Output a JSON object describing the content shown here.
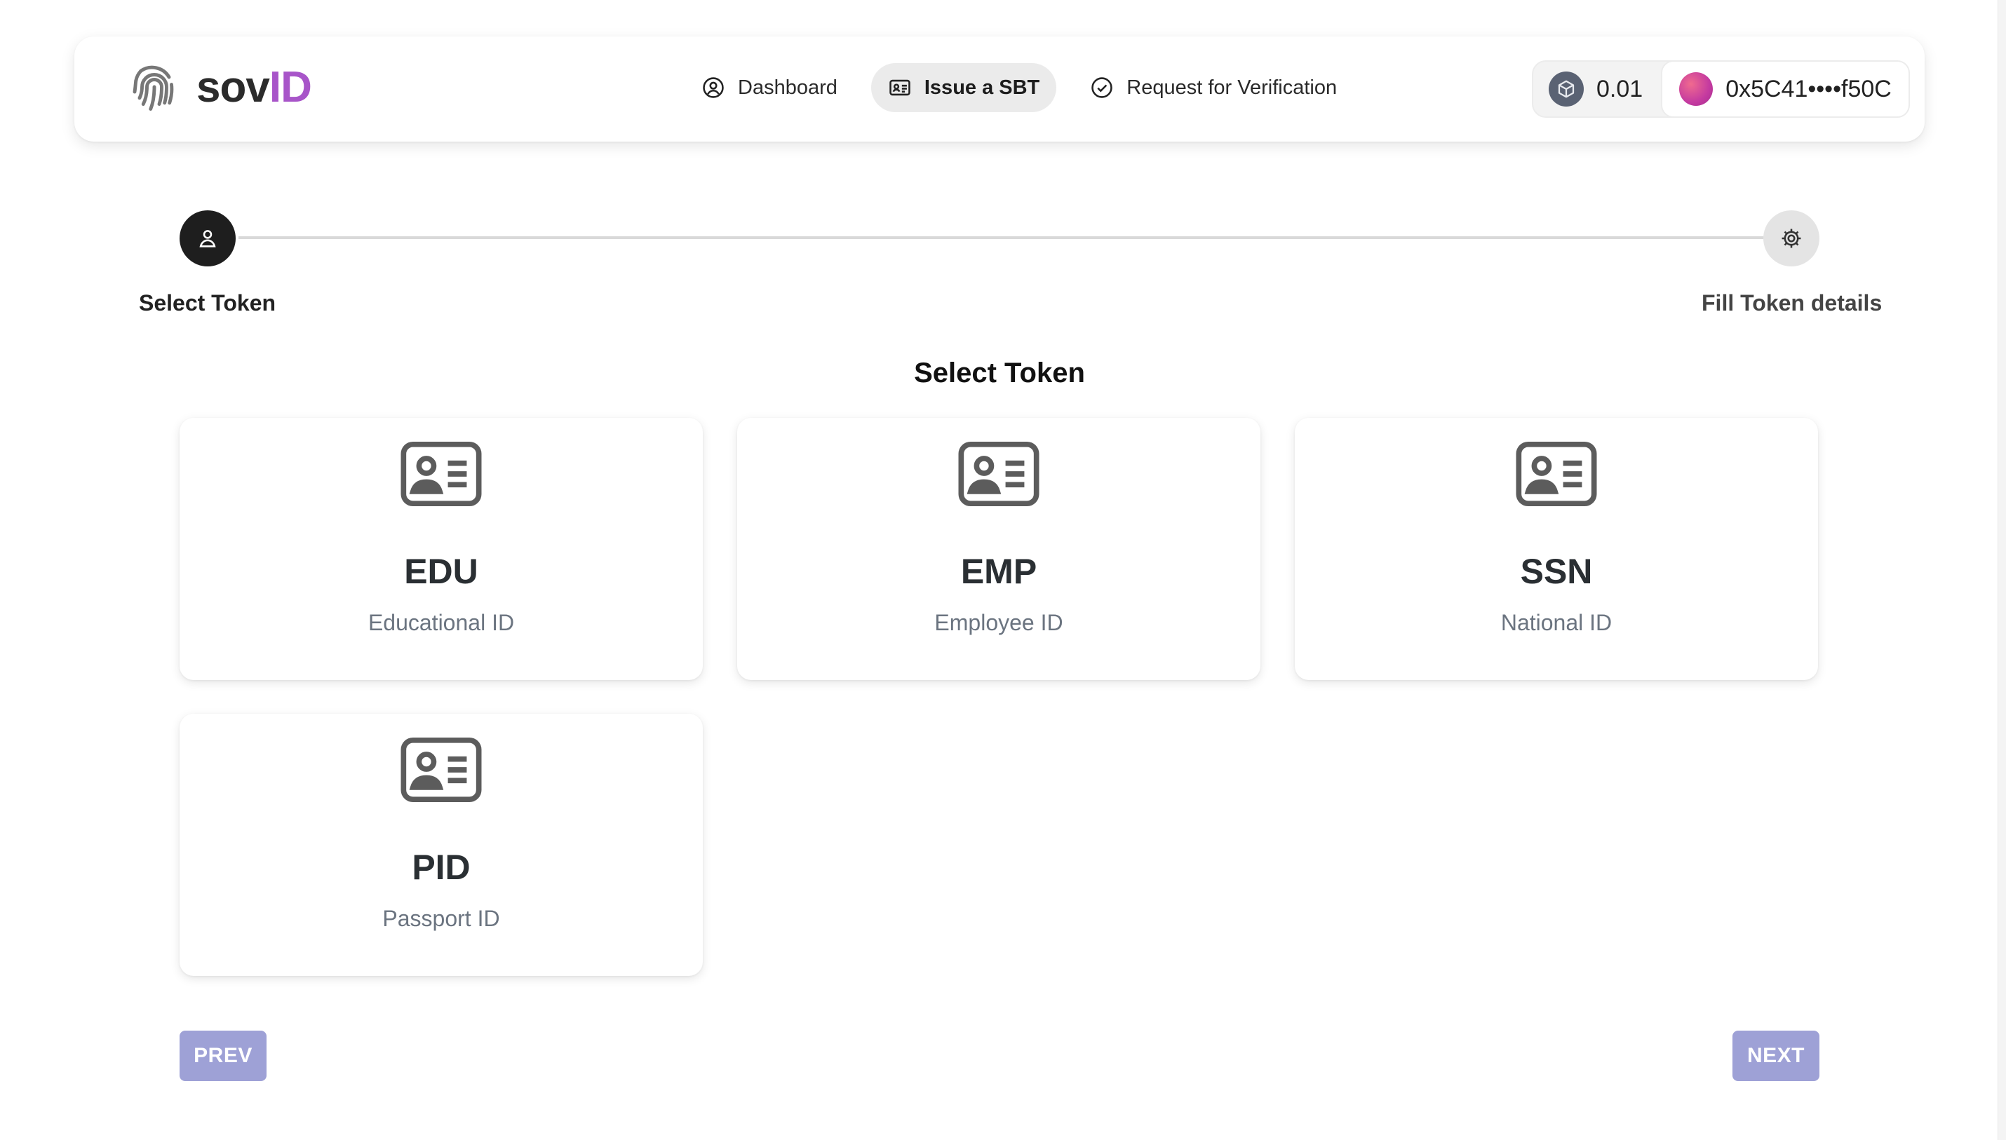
{
  "header": {
    "logo": {
      "part1": "sov",
      "part2": "ID",
      "icon": "fingerprint-icon"
    },
    "nav": [
      {
        "label": "Dashboard",
        "icon": "user-circle-icon",
        "active": false
      },
      {
        "label": "Issue a SBT",
        "icon": "id-card-icon",
        "active": true
      },
      {
        "label": "Request for Verification",
        "icon": "check-circle-icon",
        "active": false
      }
    ],
    "wallet": {
      "balance": "0.01",
      "address": "0x5C41••••f50C"
    }
  },
  "stepper": {
    "steps": [
      {
        "label": "Select Token",
        "icon": "user-icon",
        "state": "active"
      },
      {
        "label": "Fill Token details",
        "icon": "gear-icon",
        "state": "inactive"
      }
    ]
  },
  "main": {
    "title": "Select Token",
    "tokens": [
      {
        "code": "EDU",
        "desc": "Educational ID"
      },
      {
        "code": "EMP",
        "desc": "Employee ID"
      },
      {
        "code": "SSN",
        "desc": "National ID"
      },
      {
        "code": "PID",
        "desc": "Passport ID"
      }
    ]
  },
  "buttons": {
    "prev": "PREV",
    "next": "NEXT"
  },
  "colors": {
    "accent": "#a855c9",
    "button": "#9ea1d6",
    "step_active": "#1e1e1e"
  }
}
